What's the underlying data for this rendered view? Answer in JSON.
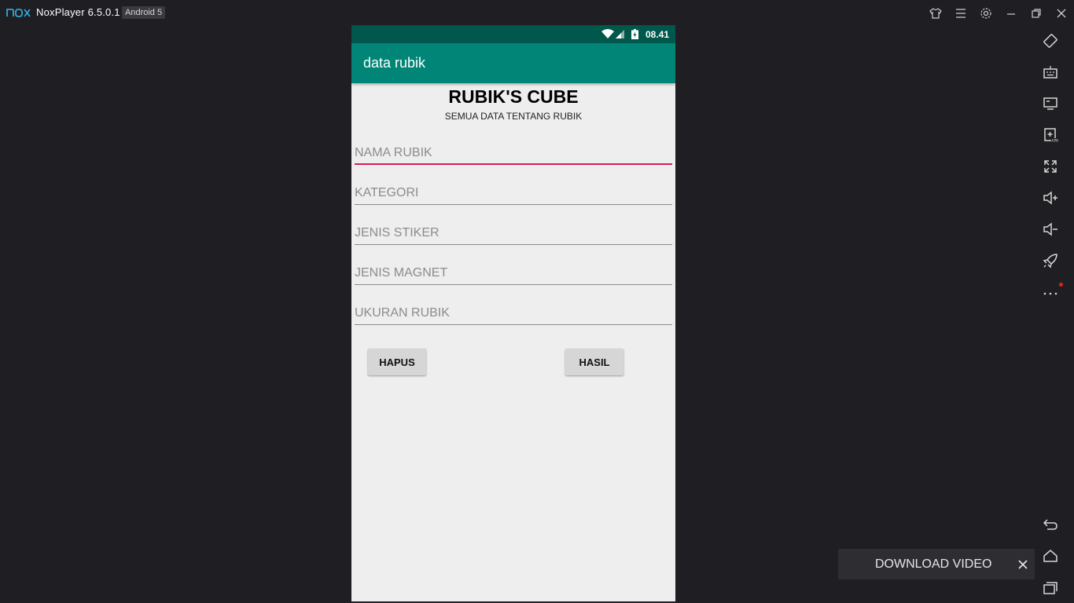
{
  "window": {
    "app_title": "NoxPlayer 6.5.0.1",
    "android_badge": "Android 5",
    "controls": [
      "skin-icon",
      "menu-icon",
      "settings-icon",
      "minimize-icon",
      "restore-icon",
      "close-icon"
    ]
  },
  "statusbar": {
    "time": "08.41"
  },
  "appbar": {
    "title": "data rubik"
  },
  "main": {
    "heading": "RUBIK'S CUBE",
    "subheading": "SEMUA DATA TENTANG RUBIK",
    "fields": [
      {
        "placeholder": "NAMA RUBIK",
        "focused": true
      },
      {
        "placeholder": "KATEGORI"
      },
      {
        "placeholder": "JENIS STIKER"
      },
      {
        "placeholder": "JENIS MAGNET"
      },
      {
        "placeholder": "UKURAN RUBIK"
      }
    ],
    "buttons": {
      "clear": "HAPUS",
      "result": "HASIL"
    }
  },
  "toolbar": {
    "items": [
      "rotate-icon",
      "keyboard-icon",
      "screen-icon",
      "apk-install-icon",
      "fullscreen-icon",
      "volume-up-icon",
      "volume-down-icon",
      "rocket-icon",
      "more-icon",
      "back-icon",
      "home-icon",
      "recents-icon"
    ]
  },
  "toast": {
    "label": "DOWNLOAD VIDEO"
  },
  "colors": {
    "statusbar": "#00574b",
    "appbar": "#008577",
    "focus_accent": "#d81b60",
    "background": "#1f1f23"
  }
}
